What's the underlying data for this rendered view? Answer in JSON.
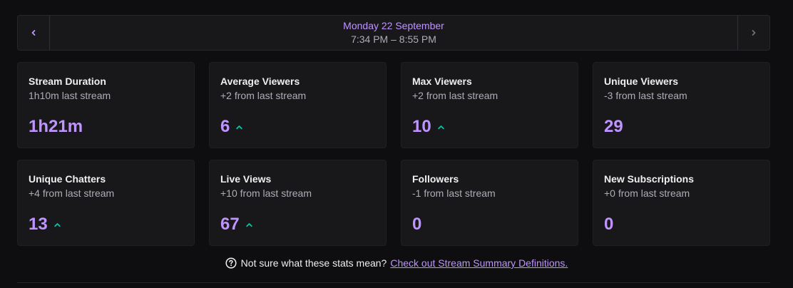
{
  "header": {
    "date": "Monday 22 September",
    "time_range": "7:34 PM – 8:55 PM"
  },
  "accent_color": "#bf94ff",
  "trend_up_color": "#00c9a7",
  "stats": [
    {
      "title": "Stream Duration",
      "subtitle": "1h10m last stream",
      "value": "1h21m",
      "trend": "none"
    },
    {
      "title": "Average Viewers",
      "subtitle": "+2 from last stream",
      "value": "6",
      "trend": "up"
    },
    {
      "title": "Max Viewers",
      "subtitle": "+2 from last stream",
      "value": "10",
      "trend": "up"
    },
    {
      "title": "Unique Viewers",
      "subtitle": "-3 from last stream",
      "value": "29",
      "trend": "none"
    },
    {
      "title": "Unique Chatters",
      "subtitle": "+4 from last stream",
      "value": "13",
      "trend": "up"
    },
    {
      "title": "Live Views",
      "subtitle": "+10 from last stream",
      "value": "67",
      "trend": "up"
    },
    {
      "title": "Followers",
      "subtitle": "-1 from last stream",
      "value": "0",
      "trend": "none"
    },
    {
      "title": "New Subscriptions",
      "subtitle": "+0 from last stream",
      "value": "0",
      "trend": "none"
    }
  ],
  "help": {
    "icon": "question-circle-icon",
    "text": "Not sure what these stats mean?",
    "link_text": "Check out Stream Summary Definitions."
  }
}
